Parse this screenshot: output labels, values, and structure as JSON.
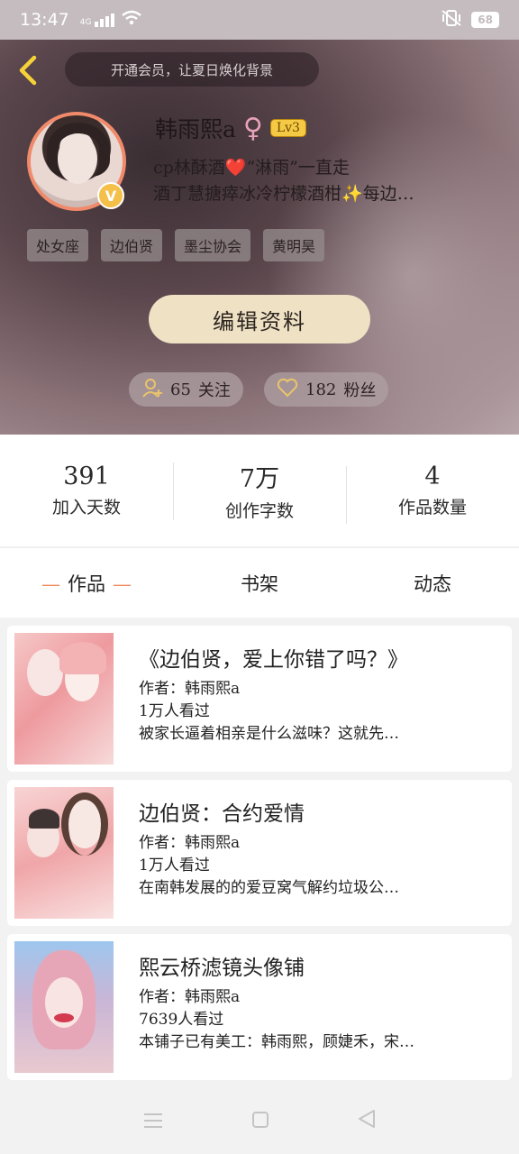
{
  "status_bar": {
    "time": "13:47",
    "network": "4G",
    "battery": "68"
  },
  "header": {
    "vip_text": "开通会员，让夏日焕化背景",
    "username": "韩雨熙a",
    "gender_symbol": "♀",
    "level": "Lv3",
    "avatar_badge": "V",
    "bio_line1": "cp林酥酒❤️“淋雨”一直走",
    "bio_line2": "酒丁慧搪瘁冰冷柠檬酒柑✨每边…",
    "tags": [
      "处女座",
      "边伯贤",
      "墨尘协会",
      "黄明昊"
    ],
    "edit_button": "编辑资料",
    "following_count": "65",
    "following_label": "关注",
    "fans_count": "182",
    "fans_label": "粉丝"
  },
  "stats": [
    {
      "value": "391",
      "label": "加入天数"
    },
    {
      "value": "7万",
      "label": "创作字数"
    },
    {
      "value": "4",
      "label": "作品数量"
    }
  ],
  "tabs": [
    "作品",
    "书架",
    "动态"
  ],
  "works": [
    {
      "title": "《边伯贤，爱上你错了吗？》",
      "author": "作者：韩雨熙a",
      "views": "1万人看过",
      "summary": "被家长逼着相亲是什么滋味？这就先…"
    },
    {
      "title": "边伯贤：合约爱情",
      "author": "作者：韩雨熙a",
      "views": "1万人看过",
      "summary": "在南韩发展的的爱豆窝气解约垃圾公…"
    },
    {
      "title": "熙云桥滤镜头像铺",
      "author": "作者：韩雨熙a",
      "views": "7639人看过",
      "summary": "本铺子已有美工：韩雨熙，顾婕禾，宋…"
    }
  ],
  "colors": {
    "accent_orange": "#f08a5b",
    "level_gold": "#f6c945",
    "edit_button_bg": "#eee1c4"
  }
}
